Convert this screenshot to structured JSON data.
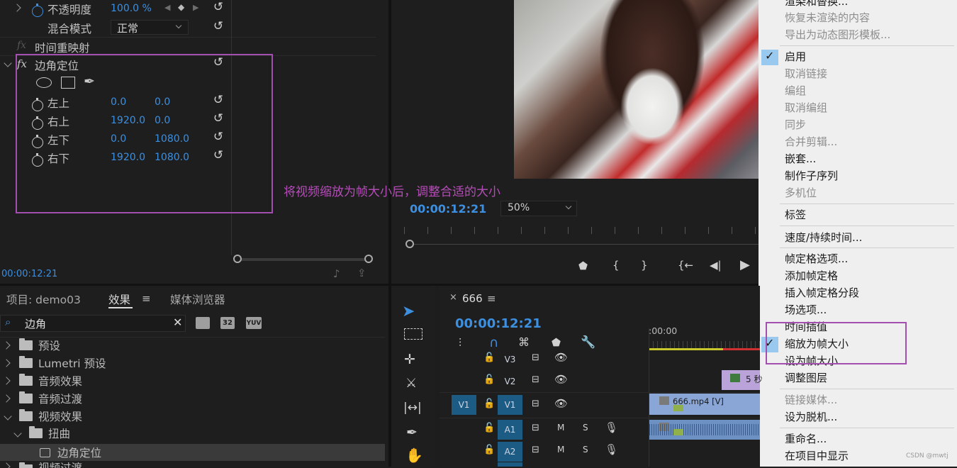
{
  "effect_controls": {
    "opacity": {
      "label": "不透明度",
      "value": "100.0 %"
    },
    "blend": {
      "label": "混合模式",
      "value": "正常"
    },
    "time_remap": {
      "label": "时间重映射"
    },
    "corner_pin": {
      "label": "边角定位"
    },
    "params": [
      {
        "label": "左上",
        "x": "0.0",
        "y": "0.0"
      },
      {
        "label": "右上",
        "x": "1920.0",
        "y": "0.0"
      },
      {
        "label": "左下",
        "x": "0.0",
        "y": "1080.0"
      },
      {
        "label": "右下",
        "x": "1920.0",
        "y": "1080.0"
      }
    ],
    "timecode": "00:00:12:21",
    "fx": "fx"
  },
  "annotation": "将视频缩放为帧大小后，调整合适的大小",
  "program": {
    "timecode": "00:00:12:21",
    "zoom": "50%"
  },
  "context_menu": {
    "items": [
      {
        "label": "渲染和替换...",
        "disabled": false
      },
      {
        "label": "恢复未渲染的内容",
        "disabled": true
      },
      {
        "label": "导出为动态图形模板...",
        "disabled": true
      },
      {
        "label": "启用",
        "checked": true
      },
      {
        "label": "取消链接",
        "disabled": true
      },
      {
        "label": "编组",
        "disabled": true
      },
      {
        "label": "取消编组",
        "disabled": true
      },
      {
        "label": "同步",
        "disabled": true
      },
      {
        "label": "合并剪辑...",
        "disabled": true
      },
      {
        "label": "嵌套..."
      },
      {
        "label": "制作子序列"
      },
      {
        "label": "多机位",
        "disabled": true
      },
      {
        "label": "标签"
      },
      {
        "label": "速度/持续时间..."
      },
      {
        "label": "帧定格选项..."
      },
      {
        "label": "添加帧定格"
      },
      {
        "label": "插入帧定格分段"
      },
      {
        "label": "场选项..."
      },
      {
        "label": "时间插值"
      },
      {
        "label": "缩放为帧大小",
        "checked": true
      },
      {
        "label": "设为帧大小"
      },
      {
        "label": "调整图层"
      },
      {
        "label": "链接媒体...",
        "disabled": true
      },
      {
        "label": "设为脱机..."
      },
      {
        "label": "重命名..."
      },
      {
        "label": "在项目中显示"
      }
    ],
    "watermark": "CSDN @mwtj"
  },
  "project_panel": {
    "tabs": [
      "项目: demo03",
      "效果",
      "媒体浏览器"
    ],
    "search_value": "边角",
    "badges": [
      "32",
      "YUV"
    ],
    "tree": [
      {
        "label": "预设",
        "depth": 0,
        "expanded": false
      },
      {
        "label": "Lumetri 预设",
        "depth": 0,
        "expanded": false
      },
      {
        "label": "音频效果",
        "depth": 0,
        "expanded": false
      },
      {
        "label": "音频过渡",
        "depth": 0,
        "expanded": false
      },
      {
        "label": "视频效果",
        "depth": 0,
        "expanded": true
      },
      {
        "label": "扭曲",
        "depth": 1,
        "expanded": true
      },
      {
        "label": "边角定位",
        "depth": 2,
        "selected": true
      },
      {
        "label": "视频过渡",
        "depth": 0,
        "expanded": false
      }
    ]
  },
  "timeline": {
    "tab": "666",
    "timecode": "00:00:12:21",
    "ruler": ":00:00",
    "tracks": [
      {
        "name": "V3",
        "src": ""
      },
      {
        "name": "V2",
        "src": ""
      },
      {
        "name": "V1",
        "src": "V1"
      },
      {
        "name": "A1",
        "src": "",
        "m": "M",
        "s": "S"
      },
      {
        "name": "A2",
        "src": "",
        "m": "M",
        "s": "S"
      }
    ],
    "clip_v1": "666.mp4 [V]",
    "clip_v2": "5 秒"
  },
  "colors": {
    "accent": "#3d8fe0",
    "annotation": "#b54db8",
    "clip": "#8aa6d6",
    "audio_clip": "#6e91c4",
    "track_active": "#1c5b84"
  }
}
